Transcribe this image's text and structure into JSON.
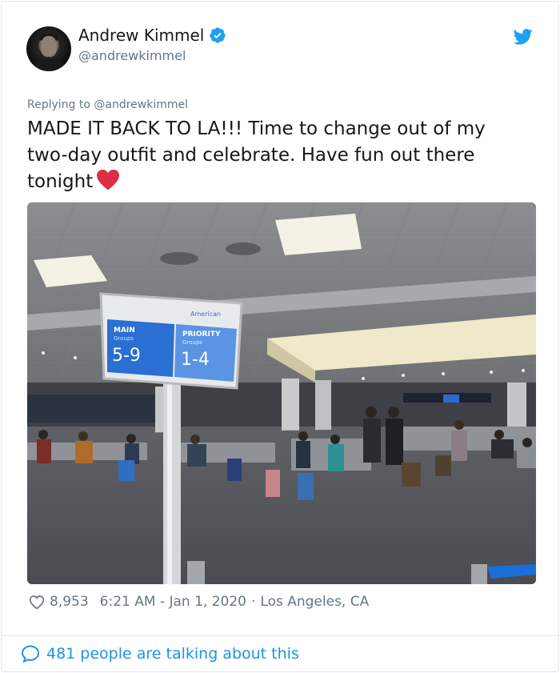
{
  "colors": {
    "link": "#1b95e0",
    "muted": "#657786",
    "text": "#14171a",
    "verified": "#1da1f2",
    "heart": "#e0245e"
  },
  "author": {
    "display_name": "Andrew Kimmel",
    "handle": "@andrewkimmel",
    "verified": true
  },
  "tweet": {
    "replying_to": "Replying to @andrewkimmel",
    "text": "MADE IT BACK TO LA!!! Time to change out of my two-day outfit and celebrate. Have fun out there tonight",
    "emoji": "red-heart"
  },
  "photo": {
    "sign": {
      "brand": "American",
      "left_title": "MAIN",
      "left_sub": "Groups",
      "left_range": "5-9",
      "right_title": "PRIORITY",
      "right_sub": "Groups",
      "right_range": "1-4"
    }
  },
  "footer": {
    "likes": "8,953",
    "time": "6:21 AM - Jan 1, 2020",
    "location": "Los Angeles, CA",
    "separator": "·",
    "talking": "481 people are talking about this"
  },
  "icons": [
    "verified-badge-icon",
    "twitter-bird-icon",
    "heart-outline-icon",
    "speech-bubble-icon",
    "red-heart-emoji"
  ]
}
